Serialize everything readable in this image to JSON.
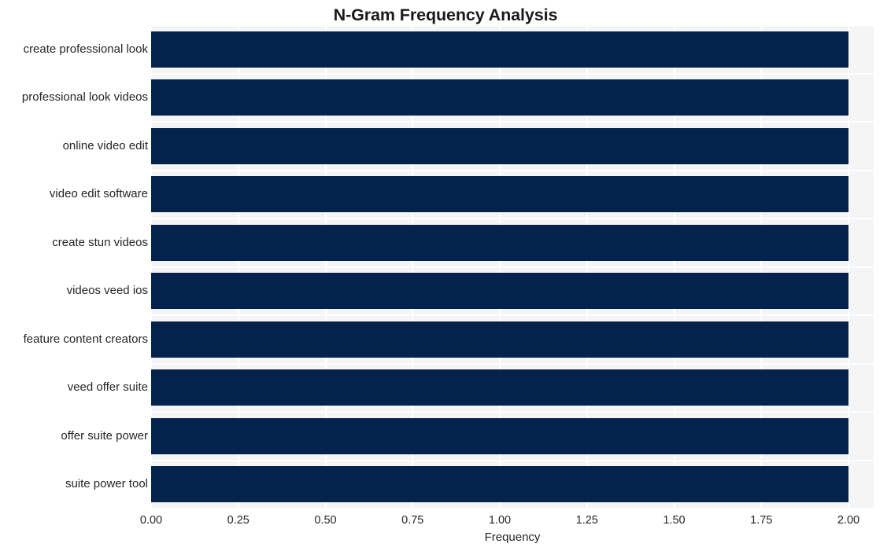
{
  "chart_data": {
    "type": "bar",
    "orientation": "horizontal",
    "title": "N-Gram Frequency Analysis",
    "xlabel": "Frequency",
    "ylabel": "",
    "categories": [
      "create professional look",
      "professional look videos",
      "online video edit",
      "video edit software",
      "create stun videos",
      "videos veed ios",
      "feature content creators",
      "veed offer suite",
      "offer suite power",
      "suite power tool"
    ],
    "values": [
      2,
      2,
      2,
      2,
      2,
      2,
      2,
      2,
      2,
      2
    ],
    "xlim": [
      0,
      2
    ],
    "xticks": [
      0,
      0.25,
      0.5,
      0.75,
      1.0,
      1.25,
      1.5,
      1.75,
      2.0
    ],
    "xtick_labels": [
      "0.00",
      "0.25",
      "0.50",
      "0.75",
      "1.00",
      "1.25",
      "1.50",
      "1.75",
      "2.00"
    ],
    "grid": true,
    "grid_color": "#ffffff",
    "legend": null,
    "bar_color": "#03234d",
    "plot_background": "#f5f5f5",
    "figure_background": "#ffffff"
  }
}
